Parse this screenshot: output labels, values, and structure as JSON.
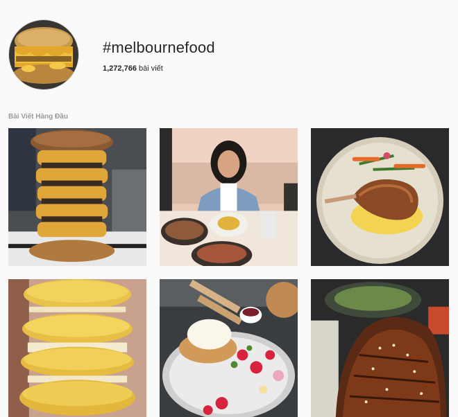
{
  "hashtag": {
    "name": "#melbournefood",
    "post_count": "1,272,766",
    "post_unit": "bài viết"
  },
  "top_posts": {
    "label": "Bài Viết Hàng Đầu",
    "items": [
      {
        "subject": "stacked-cheeseburger"
      },
      {
        "subject": "woman-at-brunch-table"
      },
      {
        "subject": "duck-leg-on-plate"
      },
      {
        "subject": "yellow-macaron-burgers"
      },
      {
        "subject": "pancake-dessert-with-berries"
      },
      {
        "subject": "glazed-pork-ribs"
      }
    ]
  }
}
